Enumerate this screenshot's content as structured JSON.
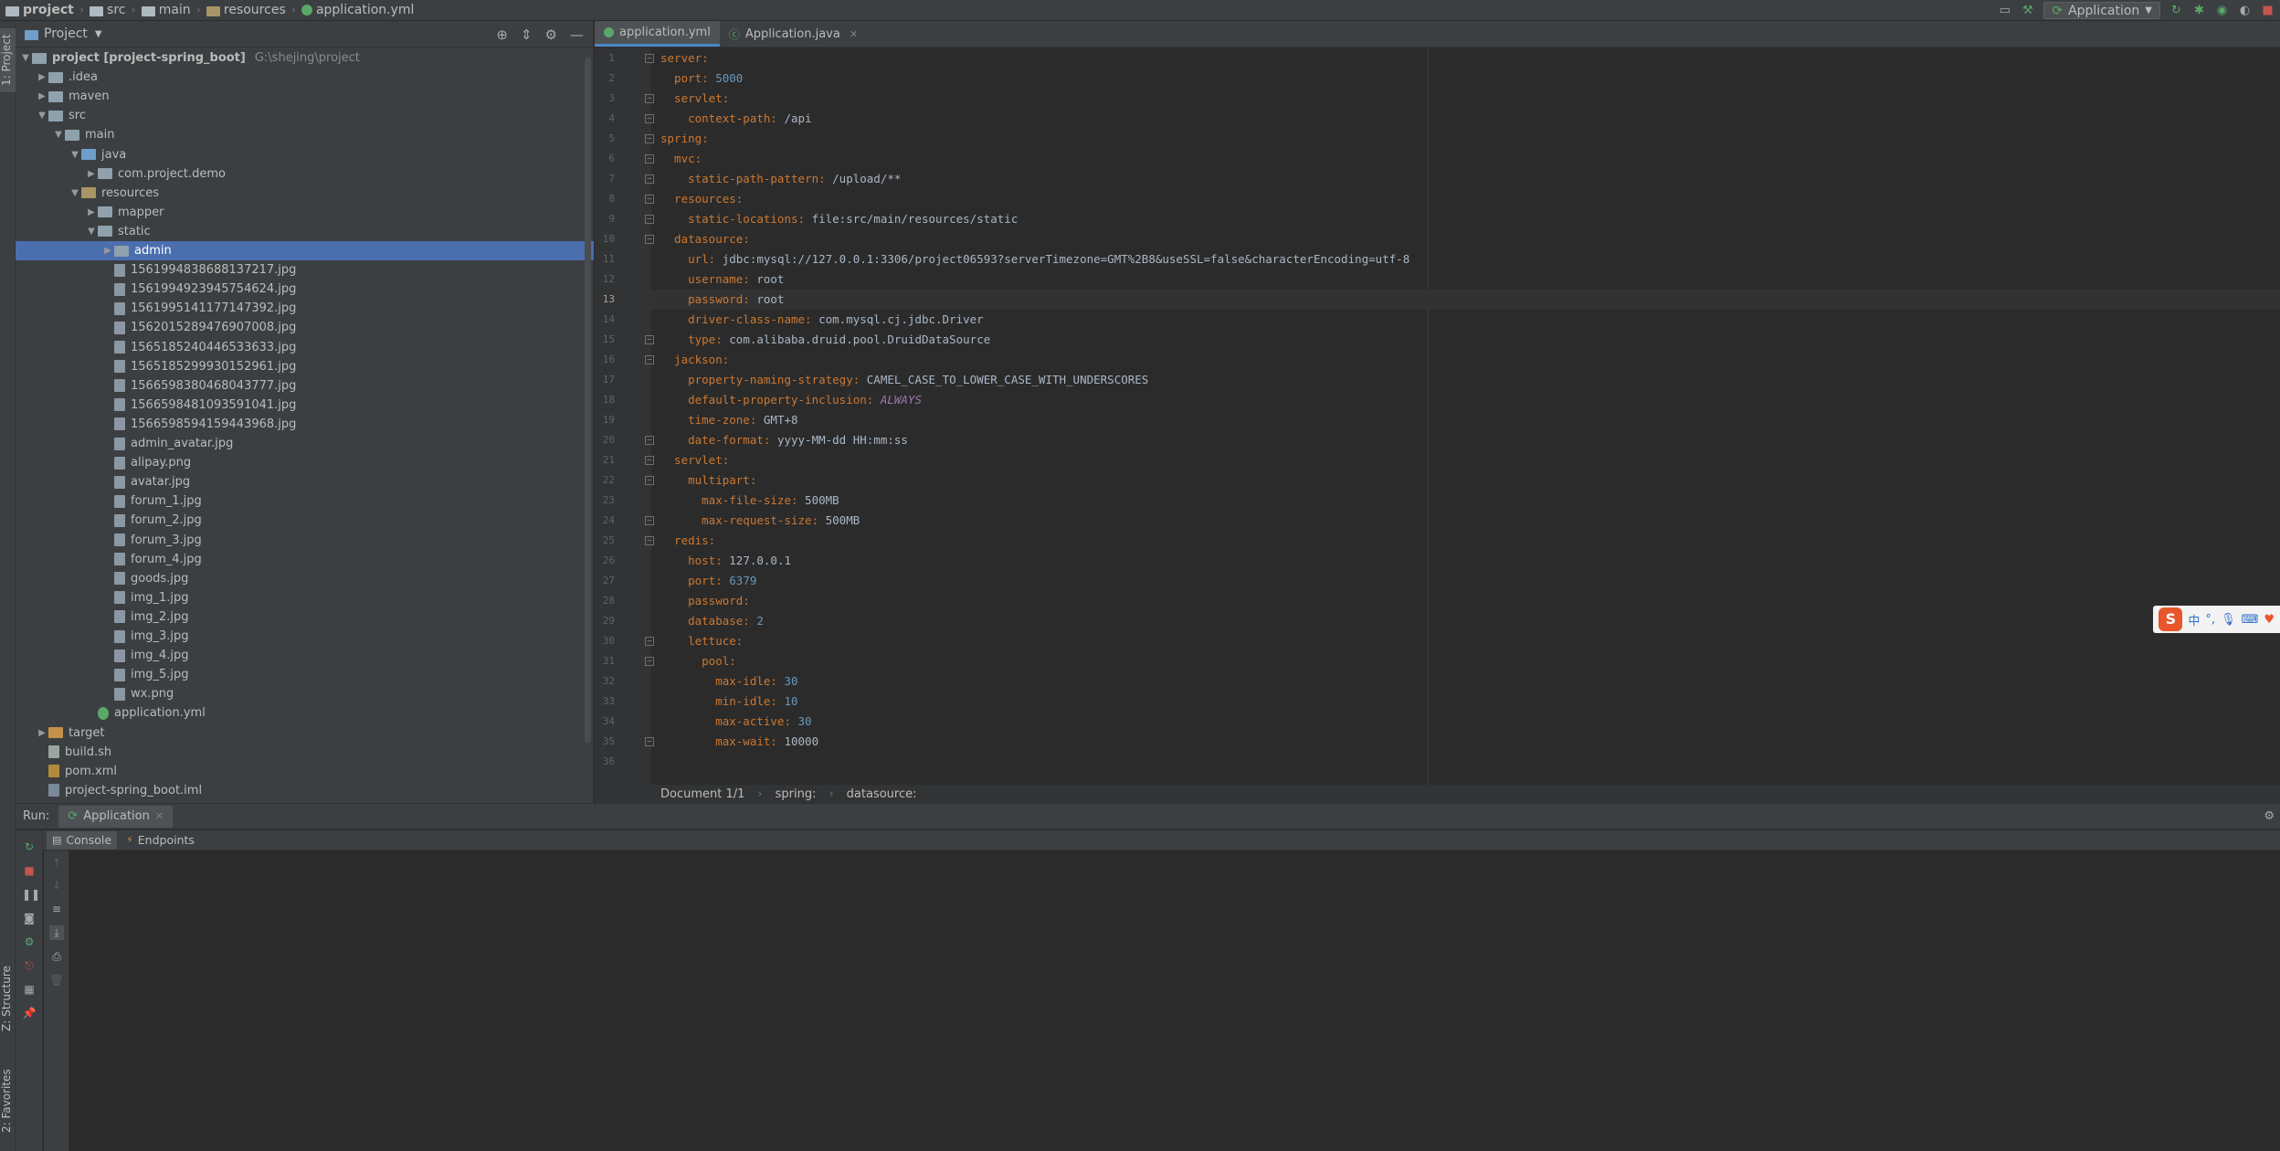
{
  "navbar": {
    "crumbs": [
      "project",
      "src",
      "main",
      "resources",
      "application.yml"
    ],
    "run_config": "Application"
  },
  "project_panel": {
    "title": "Project",
    "tree": [
      {
        "label": "project [project-spring_boot]",
        "path": "G:\\shejing\\project",
        "depth": 0,
        "arrow": "open",
        "icon": "folder"
      },
      {
        "label": ".idea",
        "depth": 1,
        "arrow": "closed",
        "icon": "folder"
      },
      {
        "label": "maven",
        "depth": 1,
        "arrow": "closed",
        "icon": "folder"
      },
      {
        "label": "src",
        "depth": 1,
        "arrow": "open",
        "icon": "folder"
      },
      {
        "label": "main",
        "depth": 2,
        "arrow": "open",
        "icon": "folder"
      },
      {
        "label": "java",
        "depth": 3,
        "arrow": "open",
        "icon": "folder-blue"
      },
      {
        "label": "com.project.demo",
        "depth": 4,
        "arrow": "closed",
        "icon": "package"
      },
      {
        "label": "resources",
        "depth": 3,
        "arrow": "open",
        "icon": "folder-res"
      },
      {
        "label": "mapper",
        "depth": 4,
        "arrow": "closed",
        "icon": "folder"
      },
      {
        "label": "static",
        "depth": 4,
        "arrow": "open",
        "icon": "folder"
      },
      {
        "label": "admin",
        "depth": 5,
        "arrow": "closed",
        "icon": "folder",
        "selected": true
      },
      {
        "label": "1561994838688137217.jpg",
        "depth": 5,
        "icon": "image"
      },
      {
        "label": "1561994923945754624.jpg",
        "depth": 5,
        "icon": "image"
      },
      {
        "label": "1561995141177147392.jpg",
        "depth": 5,
        "icon": "image"
      },
      {
        "label": "1562015289476907008.jpg",
        "depth": 5,
        "icon": "image"
      },
      {
        "label": "1565185240446533633.jpg",
        "depth": 5,
        "icon": "image"
      },
      {
        "label": "1565185299930152961.jpg",
        "depth": 5,
        "icon": "image"
      },
      {
        "label": "1566598380468043777.jpg",
        "depth": 5,
        "icon": "image"
      },
      {
        "label": "1566598481093591041.jpg",
        "depth": 5,
        "icon": "image"
      },
      {
        "label": "1566598594159443968.jpg",
        "depth": 5,
        "icon": "image"
      },
      {
        "label": "admin_avatar.jpg",
        "depth": 5,
        "icon": "image"
      },
      {
        "label": "alipay.png",
        "depth": 5,
        "icon": "image"
      },
      {
        "label": "avatar.jpg",
        "depth": 5,
        "icon": "image"
      },
      {
        "label": "forum_1.jpg",
        "depth": 5,
        "icon": "image"
      },
      {
        "label": "forum_2.jpg",
        "depth": 5,
        "icon": "image"
      },
      {
        "label": "forum_3.jpg",
        "depth": 5,
        "icon": "image"
      },
      {
        "label": "forum_4.jpg",
        "depth": 5,
        "icon": "image"
      },
      {
        "label": "goods.jpg",
        "depth": 5,
        "icon": "image"
      },
      {
        "label": "img_1.jpg",
        "depth": 5,
        "icon": "image"
      },
      {
        "label": "img_2.jpg",
        "depth": 5,
        "icon": "image"
      },
      {
        "label": "img_3.jpg",
        "depth": 5,
        "icon": "image"
      },
      {
        "label": "img_4.jpg",
        "depth": 5,
        "icon": "image"
      },
      {
        "label": "img_5.jpg",
        "depth": 5,
        "icon": "image"
      },
      {
        "label": "wx.png",
        "depth": 5,
        "icon": "image"
      },
      {
        "label": "application.yml",
        "depth": 4,
        "icon": "yml"
      },
      {
        "label": "target",
        "depth": 1,
        "arrow": "closed",
        "icon": "folder-orange",
        "dim": true
      },
      {
        "label": "build.sh",
        "depth": 1,
        "icon": "sh"
      },
      {
        "label": "pom.xml",
        "depth": 1,
        "icon": "xml"
      },
      {
        "label": "project-spring_boot.iml",
        "depth": 1,
        "icon": "iml"
      }
    ]
  },
  "editor": {
    "tabs": [
      {
        "label": "application.yml",
        "active": true
      },
      {
        "label": "Application.java",
        "active": false
      }
    ],
    "current_line": 13,
    "lines": [
      [
        {
          "t": "server:",
          "c": "k"
        }
      ],
      [
        {
          "t": "  port: ",
          "c": "k"
        },
        {
          "t": "5000",
          "c": "n"
        }
      ],
      [
        {
          "t": "  servlet:",
          "c": "k"
        }
      ],
      [
        {
          "t": "    context-path: ",
          "c": "k"
        },
        {
          "t": "/api",
          "c": "v"
        }
      ],
      [
        {
          "t": "spring:",
          "c": "k"
        }
      ],
      [
        {
          "t": "  mvc:",
          "c": "k"
        }
      ],
      [
        {
          "t": "    static-path-pattern: ",
          "c": "k"
        },
        {
          "t": "/upload/**",
          "c": "v"
        }
      ],
      [
        {
          "t": "  resources:",
          "c": "k"
        }
      ],
      [
        {
          "t": "    static-locations: ",
          "c": "k"
        },
        {
          "t": "file:src/main/resources/static",
          "c": "v"
        }
      ],
      [
        {
          "t": "  datasource:",
          "c": "k"
        }
      ],
      [
        {
          "t": "    url: ",
          "c": "k"
        },
        {
          "t": "jdbc:mysql://127.0.0.1:3306/project06593?serverTimezone=GMT%2B8&useSSL=false&characterEncoding=utf-8",
          "c": "v"
        }
      ],
      [
        {
          "t": "    username: ",
          "c": "k"
        },
        {
          "t": "root",
          "c": "v"
        }
      ],
      [
        {
          "t": "    password: ",
          "c": "k"
        },
        {
          "t": "root",
          "c": "v"
        }
      ],
      [
        {
          "t": "    driver-class-name: ",
          "c": "k"
        },
        {
          "t": "com.mysql.cj.jdbc.Driver",
          "c": "cls"
        }
      ],
      [
        {
          "t": "    type: ",
          "c": "k"
        },
        {
          "t": "com.alibaba.druid.pool.DruidDataSource",
          "c": "cls"
        }
      ],
      [
        {
          "t": "  jackson:",
          "c": "k"
        }
      ],
      [
        {
          "t": "    property-naming-strategy: ",
          "c": "k"
        },
        {
          "t": "CAMEL_CASE_TO_LOWER_CASE_WITH_UNDERSCORES",
          "c": "v"
        }
      ],
      [
        {
          "t": "    default-property-inclusion: ",
          "c": "k"
        },
        {
          "t": "ALWAYS",
          "c": "it"
        }
      ],
      [
        {
          "t": "    time-zone: ",
          "c": "k"
        },
        {
          "t": "GMT+8",
          "c": "v"
        }
      ],
      [
        {
          "t": "    date-format: ",
          "c": "k"
        },
        {
          "t": "yyyy-MM-dd HH:mm:ss",
          "c": "v"
        }
      ],
      [
        {
          "t": "  servlet:",
          "c": "k"
        }
      ],
      [
        {
          "t": "    multipart:",
          "c": "k"
        }
      ],
      [
        {
          "t": "      max-file-size: ",
          "c": "k"
        },
        {
          "t": "500MB",
          "c": "v"
        }
      ],
      [
        {
          "t": "      max-request-size: ",
          "c": "k"
        },
        {
          "t": "500MB",
          "c": "v"
        }
      ],
      [
        {
          "t": "  redis:",
          "c": "k"
        }
      ],
      [
        {
          "t": "    host: ",
          "c": "k"
        },
        {
          "t": "127.0.0.1",
          "c": "v"
        }
      ],
      [
        {
          "t": "    port: ",
          "c": "k"
        },
        {
          "t": "6379",
          "c": "n"
        }
      ],
      [
        {
          "t": "    password:",
          "c": "k"
        }
      ],
      [
        {
          "t": "    database: ",
          "c": "k"
        },
        {
          "t": "2",
          "c": "n"
        }
      ],
      [
        {
          "t": "    lettuce:",
          "c": "k"
        }
      ],
      [
        {
          "t": "      pool:",
          "c": "k"
        }
      ],
      [
        {
          "t": "        max-idle: ",
          "c": "k"
        },
        {
          "t": "30",
          "c": "n"
        }
      ],
      [
        {
          "t": "        min-idle: ",
          "c": "k"
        },
        {
          "t": "10",
          "c": "n"
        }
      ],
      [
        {
          "t": "        max-active: ",
          "c": "k"
        },
        {
          "t": "30",
          "c": "n"
        }
      ],
      [
        {
          "t": "        max-wait: ",
          "c": "k"
        },
        {
          "t": "10000",
          "c": "v"
        }
      ],
      []
    ],
    "breadcrumbs": [
      "Document 1/1",
      "spring:",
      "datasource:"
    ]
  },
  "run_panel": {
    "label": "Run:",
    "tab": "Application",
    "subtabs": [
      "Console",
      "Endpoints"
    ]
  },
  "side_tabs": {
    "project": "1: Project",
    "structure": "Z: Structure",
    "favorites": "2: Favorites"
  },
  "ime": {
    "logo": "S",
    "lang": "中"
  },
  "colors": {
    "accent": "#4b6eaf",
    "keyword": "#cc7832",
    "number": "#6897bb"
  }
}
